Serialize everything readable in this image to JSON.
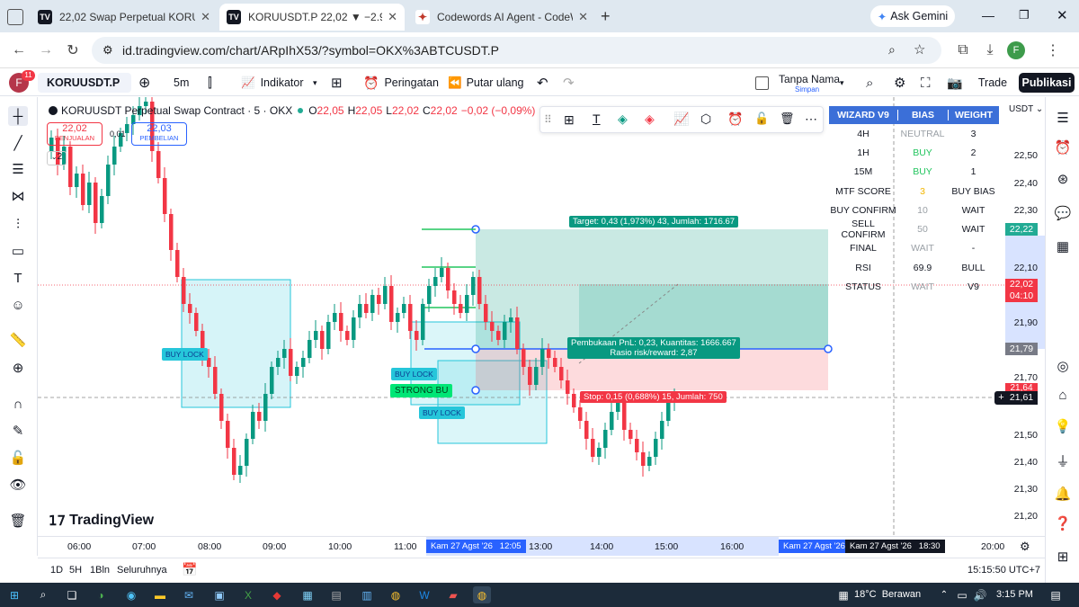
{
  "browser": {
    "tabs": [
      {
        "title": "22,02 Swap Perpetual KORU USDT",
        "icon": "tradingview-icon"
      },
      {
        "title": "KORUUSDT.P 22,02 ▼ −2.91% T",
        "icon": "tradingview-icon"
      },
      {
        "title": "Codewords AI Agent - CodeWo",
        "icon": "codewords-icon"
      }
    ],
    "ask_gemini": "Ask Gemini",
    "url": "id.tradingview.com/chart/ARpIhX53/?symbol=OKX%3ABTCUSDT.P",
    "profile_initial": "F"
  },
  "toolbar": {
    "avatar_initial": "F",
    "notif_count": "11",
    "symbol": "KORUUSDT.P",
    "interval": "5m",
    "indicators": "Indikator",
    "alerts": "Peringatan",
    "replay": "Putar ulang",
    "layout_name": "Tanpa Nama",
    "layout_sub": "Simpan",
    "trade": "Trade",
    "publish": "Publikasi"
  },
  "legend": {
    "title": "KORUUSDT Perpetual Swap Contract · 5 · OKX",
    "o_label": "O",
    "o": "22,05",
    "h_label": "H",
    "h": "22,05",
    "l_label": "L",
    "l": "22,02",
    "c_label": "C",
    "c": "22,02",
    "chg": "−0,02 (−0,09%)",
    "sell_price": "22,02",
    "sell_label": "PENJUALAN",
    "spread": "0,01",
    "buy_price": "22,03",
    "buy_label": "PEMBELIAN",
    "lots": "2"
  },
  "wizard": {
    "headers": [
      "WIZARD V9",
      "BIAS",
      "WEIGHT"
    ],
    "rows": [
      [
        "4H",
        "NEUTRAL",
        "3"
      ],
      [
        "1H",
        "BUY",
        "2"
      ],
      [
        "15M",
        "BUY",
        "1"
      ],
      [
        "MTF SCORE",
        "3",
        "BUY BIAS"
      ],
      [
        "BUY CONFIRM",
        "10",
        "WAIT"
      ],
      [
        "SELL CONFIRM",
        "50",
        "WAIT"
      ],
      [
        "FINAL",
        "WAIT",
        "-"
      ],
      [
        "RSI",
        "69.9",
        "BULL"
      ],
      [
        "STATUS",
        "WAIT",
        "V9"
      ]
    ],
    "colors": {
      "header": "#3b6fd8",
      "buy": "#22c55e",
      "wait": "#9aa0a6",
      "mtf": "#f2b600"
    }
  },
  "position": {
    "target": "Target: 0,43 (1,973%) 43, Jumlah: 1716.67",
    "open_line1": "Pembukaan PnL: 0,23, Kuantitas: 1666.667",
    "open_line2": "Rasio risk/reward: 2,87",
    "stop": "Stop: 0,15 (0,688%) 15, Jumlah: 750"
  },
  "labels": {
    "buy_lock": "BUY LOCK",
    "strong_buy": "STRONG BU",
    "watermark": "TradingView"
  },
  "price_axis": {
    "currency": "USDT",
    "ticks": [
      "22,50",
      "22,40",
      "22,30",
      "22,10",
      "21,90",
      "21,70",
      "21,50",
      "21,40",
      "21,30",
      "21,20"
    ],
    "target_price": "22,22",
    "last_price": "22,02",
    "countdown": "04:10",
    "entry_price": "21,79",
    "stop_price": "21,64",
    "cursor_price": "21,61"
  },
  "time_axis": {
    "ticks": [
      "06:00",
      "07:00",
      "08:00",
      "09:00",
      "10:00",
      "11:00",
      "13:00",
      "14:00",
      "15:00",
      "16:00",
      "20:00"
    ],
    "range_start": "Kam 27 Agst '26   12:05",
    "range_end_left": "Kam 27 Agst '26",
    "range_end": "Kam 27 Agst '26   18:30"
  },
  "bottom": {
    "ranges": [
      "1D",
      "5H",
      "1Bln",
      "Seluruhnya"
    ],
    "clock": "15:15:50 UTC+7"
  },
  "taskbar": {
    "weather": "18°C  Berawan",
    "time": "3:15 PM"
  }
}
